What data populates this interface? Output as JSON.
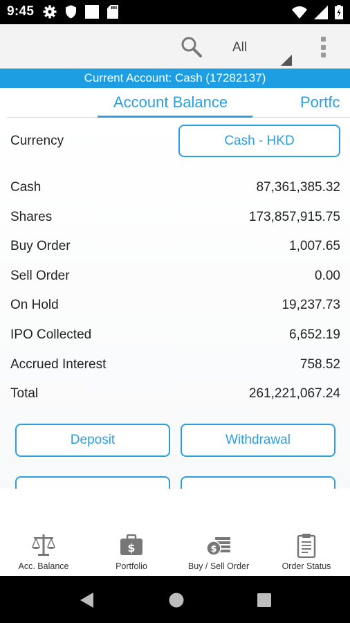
{
  "status_bar": {
    "time": "9:45",
    "icons": [
      "settings-icon",
      "shield-icon",
      "square-icon",
      "sd-card-icon",
      "wifi-icon",
      "signal-icon",
      "battery-icon"
    ]
  },
  "app_bar": {
    "filter_value": "All",
    "icons": [
      "search-icon",
      "more-vert-icon"
    ]
  },
  "account_bar": {
    "text": "Current Account: Cash (17282137)"
  },
  "tabs": [
    {
      "label": "Account Balance",
      "active": true
    },
    {
      "label": "Portfc",
      "active": false
    }
  ],
  "balance": {
    "currency_label": "Currency",
    "currency_value": "Cash - HKD",
    "rows": [
      {
        "label": "Cash",
        "value": "87,361,385.32"
      },
      {
        "label": "Shares",
        "value": "173,857,915.75"
      },
      {
        "label": "Buy Order",
        "value": "1,007.65"
      },
      {
        "label": "Sell Order",
        "value": "0.00"
      },
      {
        "label": "On Hold",
        "value": "19,237.73"
      },
      {
        "label": "IPO Collected",
        "value": "6,652.19"
      },
      {
        "label": "Accrued Interest",
        "value": "758.52"
      },
      {
        "label": "Total",
        "value": "261,221,067.24"
      }
    ],
    "deposit_label": "Deposit",
    "withdrawal_label": "Withdrawal"
  },
  "bottom_nav": [
    {
      "label": "Acc. Balance",
      "icon": "scale-icon"
    },
    {
      "label": "Portfolio",
      "icon": "briefcase-dollar-icon"
    },
    {
      "label": "Buy / Sell Order",
      "icon": "coins-icon"
    },
    {
      "label": "Order Status",
      "icon": "clipboard-icon"
    }
  ],
  "colors": {
    "accent": "#2a9ee0",
    "account_bar": "#1e9ee2",
    "app_bar": "#f3f3f3",
    "icon_gray": "#777777"
  }
}
